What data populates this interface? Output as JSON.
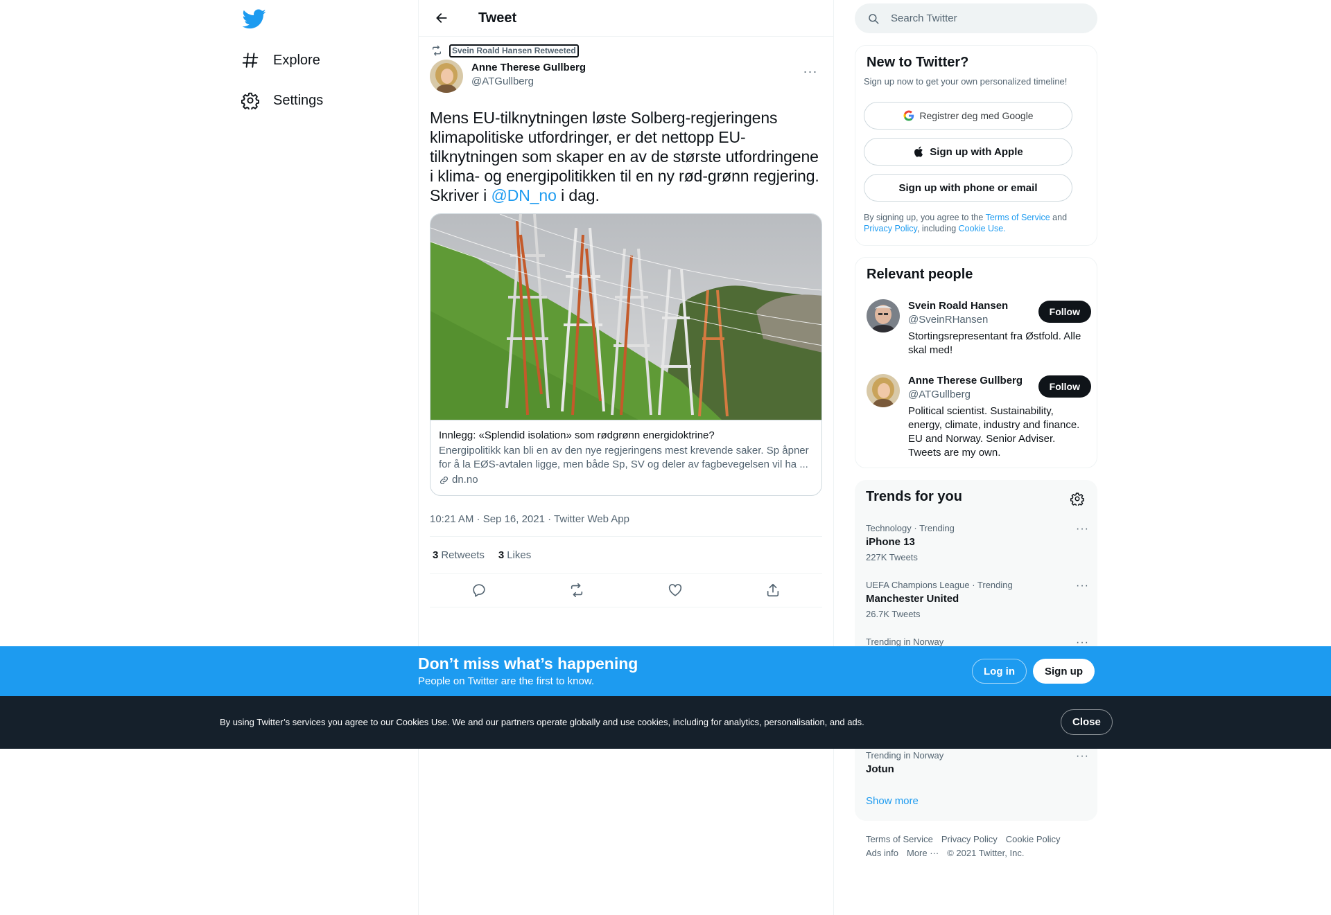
{
  "colors": {
    "accent": "#1d9bf0",
    "text": "#0f1419",
    "secondary": "#536471",
    "cookie_bar": "#15202b"
  },
  "nav": {
    "logo_icon": "twitter-bird-icon",
    "items": [
      {
        "label": "Explore",
        "icon": "hashtag-icon"
      },
      {
        "label": "Settings",
        "icon": "gear-icon"
      }
    ]
  },
  "header": {
    "title": "Tweet"
  },
  "tweet": {
    "retweeted_by": "Svein Roald Hansen Retweeted",
    "author_name": "Anne Therese Gullberg",
    "author_handle": "@ATGullberg",
    "text_before": "Mens EU-tilknytningen løste Solberg-regjeringens klimapolitiske utfordringer, er det nettopp EU-tilknytningen som skaper en av de største utfordringene i klima- og energipolitikken til en ny rød-grønn regjering. Skriver i ",
    "mention": "@DN_no",
    "text_after": " i dag.",
    "card": {
      "title": "Innlegg: «Splendid isolation» som rødgrønn energidoktrine?",
      "description": "Energipolitikk kan bli en av den nye regjeringens mest krevende saker. Sp åpner for å la EØS-avtalen ligge, men både Sp, SV og deler av fagbevegelsen vil ha ...",
      "domain": "dn.no"
    },
    "timestamp": "10:21 AM · Sep 16, 2021 · Twitter Web App",
    "retweets_count": "3",
    "retweets_label": "Retweets",
    "likes_count": "3",
    "likes_label": "Likes"
  },
  "search": {
    "placeholder": "Search Twitter"
  },
  "new_to_twitter": {
    "title": "New to Twitter?",
    "subtitle": "Sign up now to get your own personalized timeline!",
    "google_label": "Registrer deg med Google",
    "apple_label": "Sign up with Apple",
    "phone_label": "Sign up with phone or email",
    "terms_prefix": "By signing up, you agree to the ",
    "terms_link": "Terms of Service",
    "terms_and": " and ",
    "privacy_link": "Privacy Policy",
    "terms_including": ", including ",
    "cookie_link": "Cookie Use."
  },
  "relevant_people": {
    "title": "Relevant people",
    "people": [
      {
        "name": "Svein Roald Hansen",
        "handle": "@SveinRHansen",
        "bio": "Stortingsrepresentant fra Østfold. Alle skal med!",
        "follow_label": "Follow"
      },
      {
        "name": "Anne Therese Gullberg",
        "handle": "@ATGullberg",
        "bio": "Political scientist. Sustainability, energy, climate, industry and finance. EU and Norway. Senior Adviser. Tweets are my own.",
        "follow_label": "Follow"
      }
    ]
  },
  "trends": {
    "title": "Trends for you",
    "items": [
      {
        "meta": "Technology · Trending",
        "name": "iPhone 13",
        "count": "227K Tweets"
      },
      {
        "meta": "UEFA Champions League · Trending",
        "name": "Manchester United",
        "count": "26.7K Tweets"
      },
      {
        "meta": "Trending in Norway",
        "name": "",
        "count": ""
      },
      {
        "meta": "Trending in Norway",
        "name": "Jotun",
        "count": ""
      }
    ],
    "show_more": "Show more"
  },
  "footer": {
    "links": [
      "Terms of Service",
      "Privacy Policy",
      "Cookie Policy",
      "Ads info",
      "More ···"
    ],
    "copyright": "© 2021 Twitter, Inc."
  },
  "login_bar": {
    "title": "Don’t miss what’s happening",
    "subtitle": "People on Twitter are the first to know.",
    "login_label": "Log in",
    "signup_label": "Sign up"
  },
  "cookie_bar": {
    "text": "By using Twitter’s services you agree to our Cookies Use. We and our partners operate globally and use cookies, including for analytics, personalisation, and ads.",
    "close_label": "Close"
  }
}
